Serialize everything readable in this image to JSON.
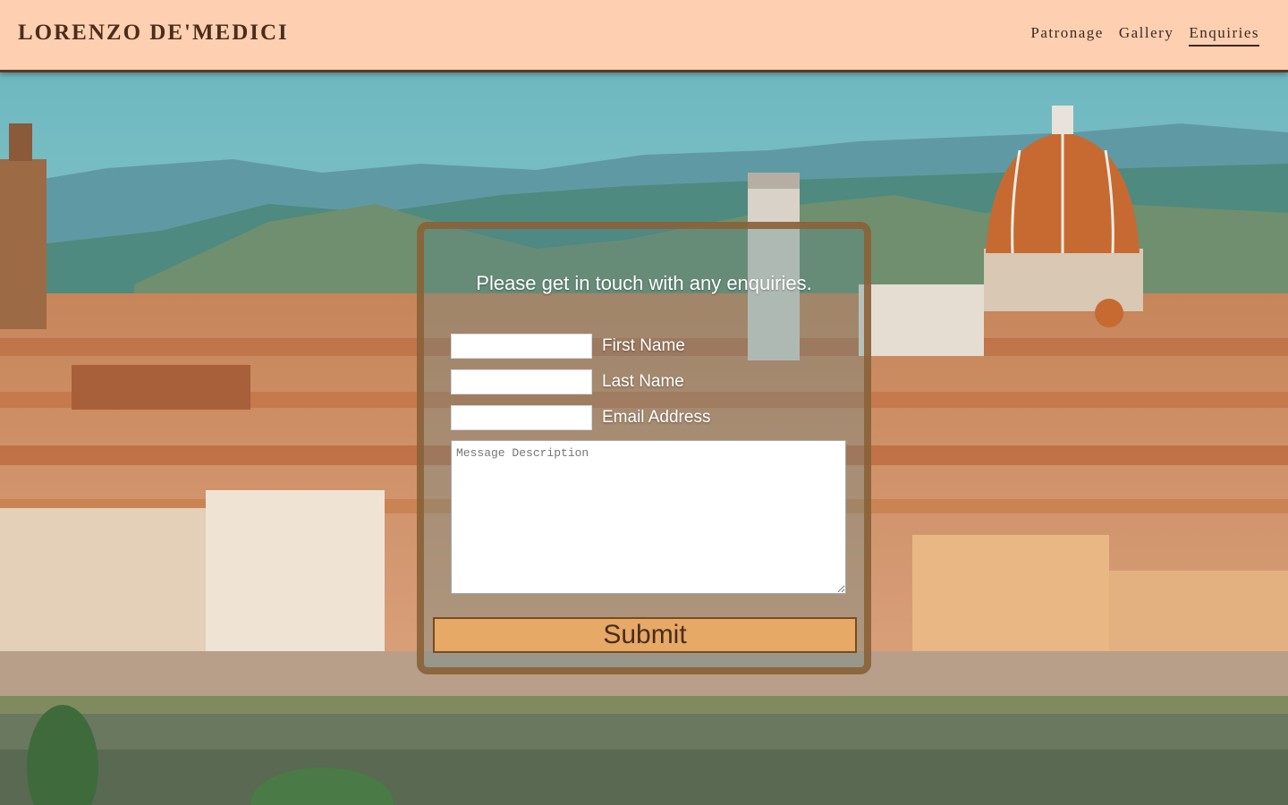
{
  "header": {
    "brand": "LORENZO DE'MEDICI",
    "nav": [
      {
        "label": "Patronage",
        "active": false
      },
      {
        "label": "Gallery",
        "active": false
      },
      {
        "label": "Enquiries",
        "active": true
      }
    ]
  },
  "form": {
    "title": "Please get in touch with any enquiries.",
    "first_name": {
      "label": "First Name",
      "value": ""
    },
    "last_name": {
      "label": "Last Name",
      "value": ""
    },
    "email": {
      "label": "Email Address",
      "value": ""
    },
    "message": {
      "placeholder": "Message Description",
      "value": ""
    },
    "submit_label": "Submit"
  },
  "colors": {
    "header_bg": "#ffcfb2",
    "brand_text": "#4a2d1c",
    "panel_border": "#8c6237",
    "submit_bg": "#ecab64"
  }
}
